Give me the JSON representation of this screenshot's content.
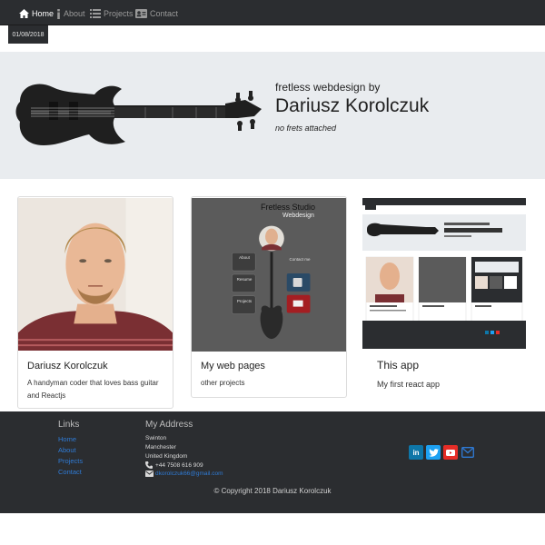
{
  "nav": {
    "items": [
      {
        "label": "Home",
        "icon": "home-icon"
      },
      {
        "label": "About",
        "icon": "info-icon"
      },
      {
        "label": "Projects",
        "icon": "list-icon"
      },
      {
        "label": "Contact",
        "icon": "contact-card-icon"
      }
    ],
    "active": "Home",
    "date": "01/08/2018"
  },
  "hero": {
    "subtitle": "fretless webdesign by",
    "title": "Dariusz Korolczuk",
    "tagline": "no frets attached"
  },
  "cards": [
    {
      "title": "Dariusz Korolczuk",
      "text": "A handyman coder that loves bass guitar and Reactjs"
    },
    {
      "title": "My web pages",
      "text": "other projects",
      "preview": {
        "title": "Fretless Studio",
        "subtitle": "Webdesign",
        "buttons": [
          "About",
          "Resume",
          "Projects"
        ],
        "contact": "Contact me"
      }
    },
    {
      "title": "This app",
      "text": "My first react app"
    }
  ],
  "footer": {
    "links_heading": "Links",
    "links": [
      "Home",
      "About",
      "Projects",
      "Contact"
    ],
    "address_heading": "My Address",
    "address_lines": [
      "Swinton",
      "Manchester",
      "United Kingdom"
    ],
    "phone": "+44 7508 616 909",
    "email": "dkorolczuk66@gmail.com",
    "copyright": "© Copyright 2018 Dariusz Korolczuk",
    "social": [
      "linkedin-icon",
      "twitter-icon",
      "youtube-icon",
      "mail-icon"
    ]
  },
  "colors": {
    "navbar": "#2b2d30",
    "hero_bg": "#e9ecef",
    "link": "#2f7bd6",
    "linkedin": "#0e76a8",
    "twitter": "#1da1f2",
    "youtube": "#e52d27"
  }
}
